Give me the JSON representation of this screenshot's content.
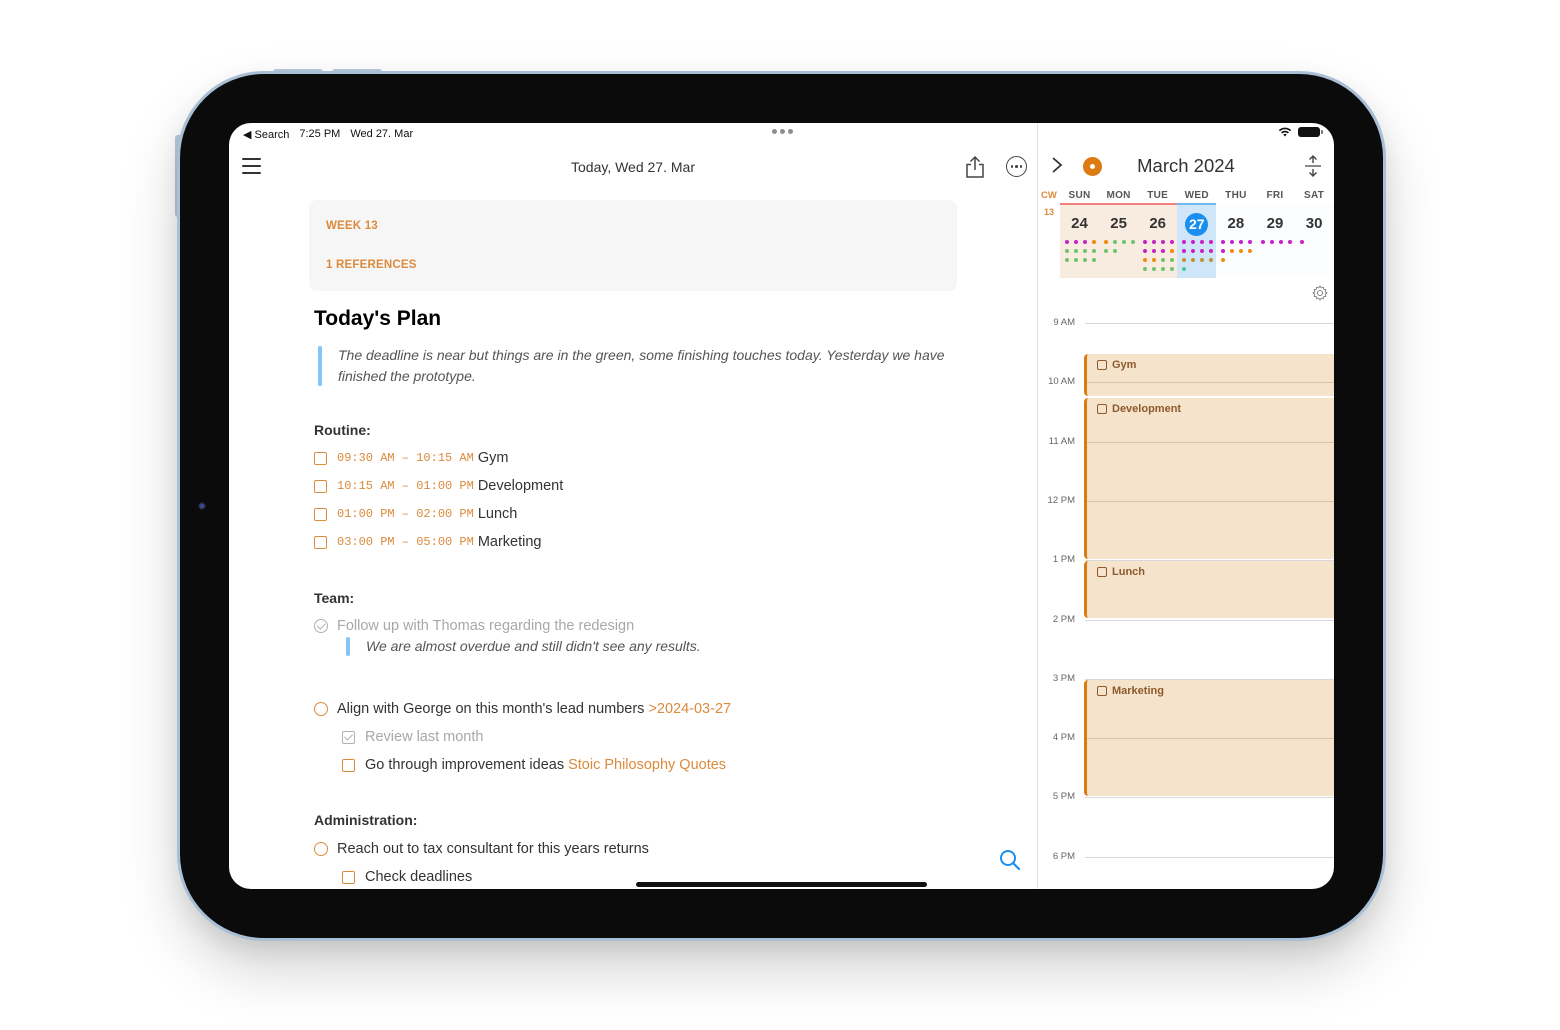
{
  "status_bar": {
    "back_label": "◀ Search",
    "time": "7:25 PM",
    "date": "Wed 27. Mar"
  },
  "header": {
    "title": "Today, Wed 27. Mar",
    "icons": [
      "menu-icon",
      "share-icon",
      "more-icon"
    ]
  },
  "note_meta": {
    "week_label": "WEEK 13",
    "references_label": "1 REFERENCES"
  },
  "note": {
    "title": "Today's Plan",
    "intro_quote": "The deadline is near but things are in the green, some finishing touches today. Yesterday we have finished the prototype.",
    "sections": {
      "routine": {
        "heading": "Routine:",
        "items": [
          {
            "time": "09:30 AM – 10:15 AM",
            "label": "Gym",
            "done": false
          },
          {
            "time": "10:15 AM – 01:00 PM",
            "label": "Development",
            "done": false
          },
          {
            "time": "01:00 PM – 02:00 PM",
            "label": "Lunch",
            "done": false
          },
          {
            "time": "03:00 PM – 05:00 PM",
            "label": "Marketing",
            "done": false
          }
        ]
      },
      "team": {
        "heading": "Team:",
        "task1": {
          "label": "Follow up with Thomas regarding the redesign",
          "done": true
        },
        "task1_quote": "We are almost overdue and still didn't see any results.",
        "task2": {
          "label": "Align with George on this month's lead numbers",
          "date_link": ">2024-03-27",
          "done": false
        },
        "subtasks": [
          {
            "label": "Review last month",
            "done": true
          },
          {
            "label": "Go through improvement ideas",
            "link": "Stoic Philosophy Quotes",
            "done": false
          }
        ]
      },
      "administration": {
        "heading": "Administration:",
        "task1": {
          "label": "Reach out to tax consultant for this years returns",
          "done": false
        },
        "subtasks": [
          {
            "label": "Check deadlines",
            "done": false
          }
        ]
      }
    }
  },
  "calendar": {
    "month_title": "March 2024",
    "cw_label": "CW",
    "cw_number": "13",
    "weekdays": [
      "SUN",
      "MON",
      "TUE",
      "WED",
      "THU",
      "FRI",
      "SAT"
    ],
    "days": [
      {
        "num": "24",
        "dots": [
          "#c81fc8",
          "#c81fc8",
          "#c81fc8",
          "#ee8c10",
          "#6cc36c",
          "#6cc36c",
          "#6cc36c",
          "#6cc36c",
          "#6cc36c",
          "#6cc36c",
          "#6cc36c",
          "#6cc36c"
        ]
      },
      {
        "num": "25",
        "dots": [
          "#ee8c10",
          "#6cc36c",
          "#6cc36c",
          "#6cc36c",
          "#6cc36c",
          "#6cc36c"
        ]
      },
      {
        "num": "26",
        "dots": [
          "#c81fc8",
          "#c81fc8",
          "#c81fc8",
          "#c81fc8",
          "#c81fc8",
          "#c81fc8",
          "#c81fc8",
          "#ee8c10",
          "#ee8c10",
          "#ee8c10",
          "#6cc36c",
          "#6cc36c",
          "#6cc36c",
          "#6cc36c",
          "#6cc36c",
          "#6cc36c"
        ]
      },
      {
        "num": "27",
        "today": true,
        "dots": [
          "#c81fc8",
          "#c81fc8",
          "#c81fc8",
          "#c81fc8",
          "#c81fc8",
          "#c81fc8",
          "#c81fc8",
          "#c81fc8",
          "#bf9332",
          "#bf9332",
          "#bf9332",
          "#bf9332",
          "#4ec89a"
        ]
      },
      {
        "num": "28",
        "dots": [
          "#c81fc8",
          "#c81fc8",
          "#c81fc8",
          "#c81fc8",
          "#c81fc8",
          "#ee8c10",
          "#ee8c10",
          "#ee8c10",
          "#ee8c10"
        ]
      },
      {
        "num": "29",
        "dots": [
          "#c81fc8",
          "#c81fc8",
          "#c81fc8",
          "#c81fc8"
        ]
      },
      {
        "num": "30",
        "dots": [
          "#c81fc8"
        ]
      }
    ],
    "hours": [
      "9 AM",
      "10 AM",
      "11 AM",
      "12 PM",
      "1 PM",
      "2 PM",
      "3 PM",
      "4 PM",
      "5 PM",
      "6 PM"
    ],
    "events": [
      {
        "title": "Gym",
        "start": 9.5,
        "end": 10.25
      },
      {
        "title": "Development",
        "start": 10.25,
        "end": 13.0
      },
      {
        "title": "Lunch",
        "start": 13.0,
        "end": 14.0
      },
      {
        "title": "Marketing",
        "start": 15.0,
        "end": 17.0
      }
    ]
  },
  "colors": {
    "accent": "#dc8a3c",
    "today_blue": "#1a8ff0",
    "event_bg": "#f6e3cc",
    "event_border": "#dd7a12"
  }
}
